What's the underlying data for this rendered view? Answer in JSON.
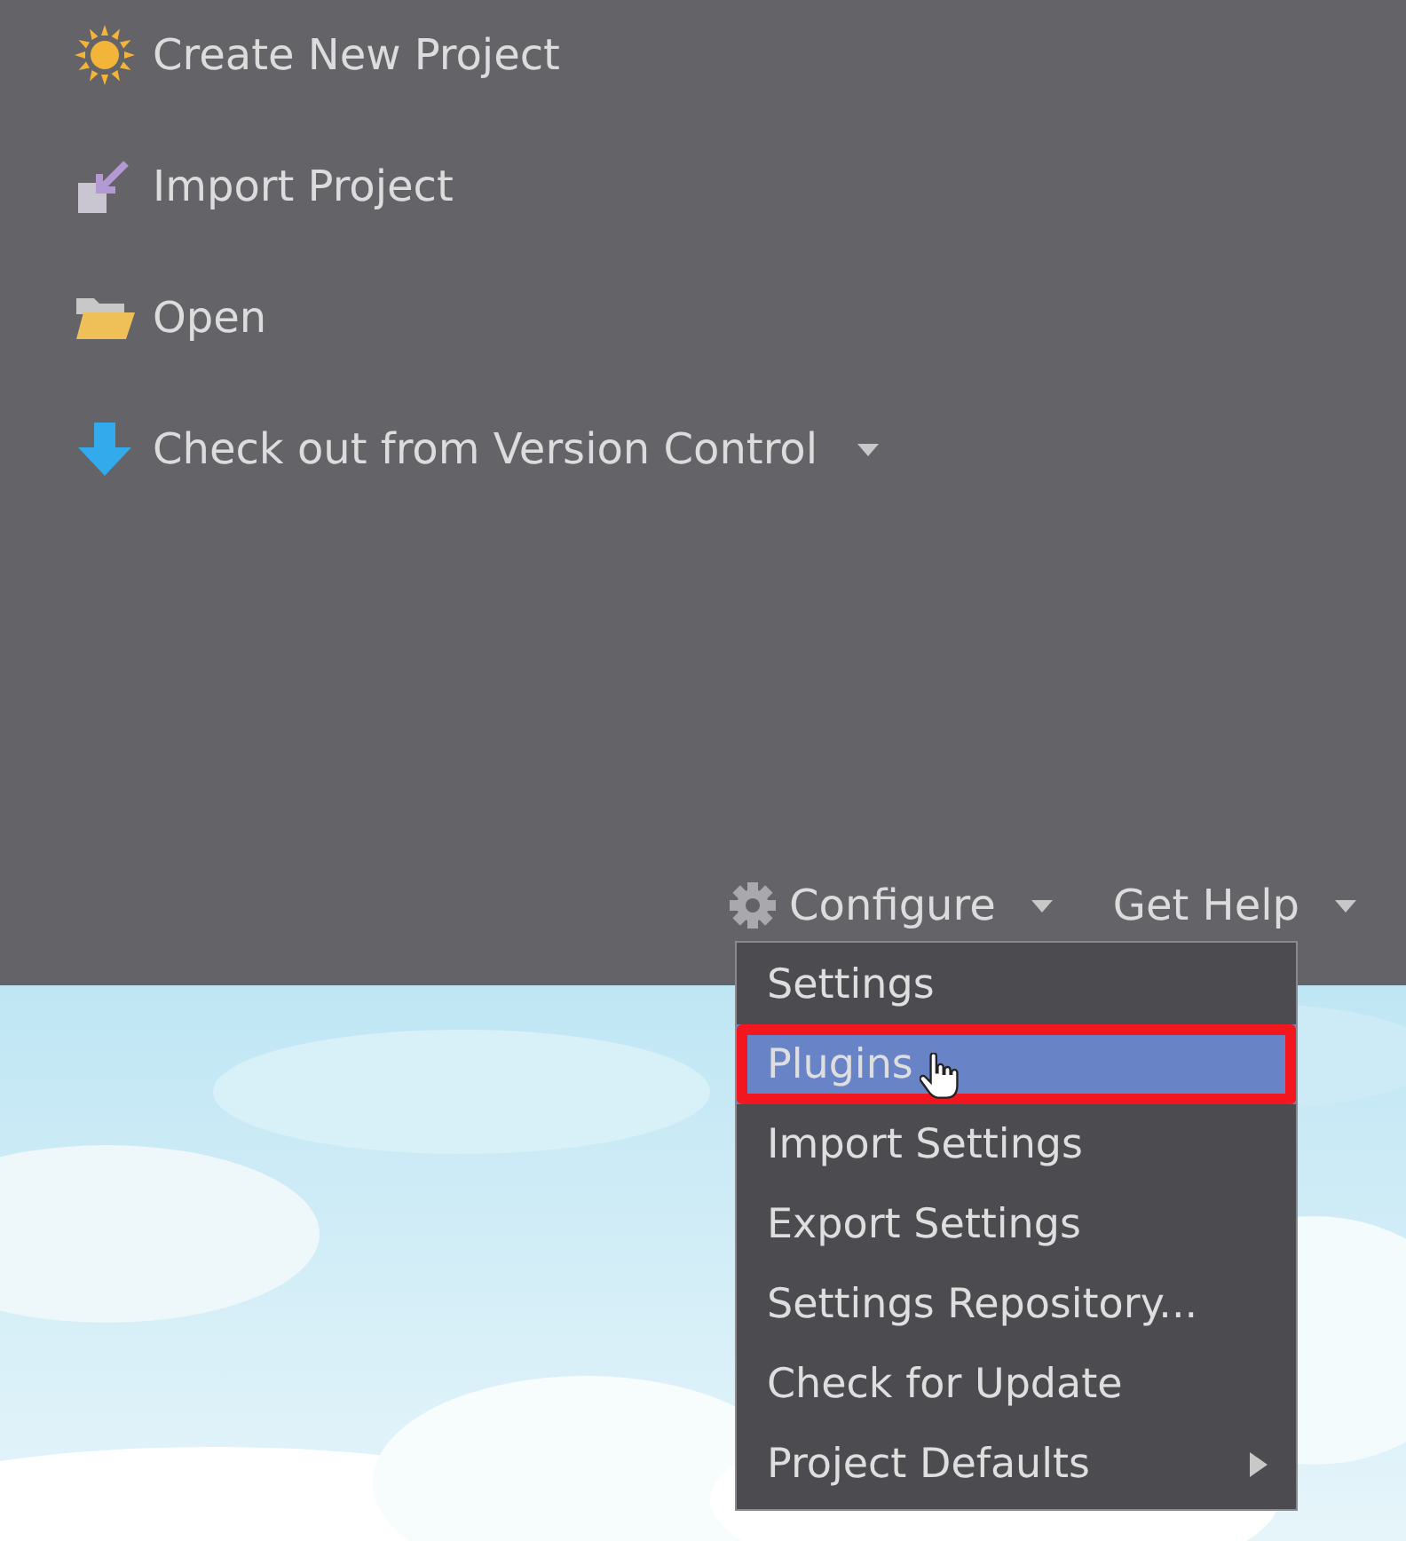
{
  "actions": [
    {
      "label": "Create New Project",
      "kind": "new",
      "dropdown": false
    },
    {
      "label": "Import Project",
      "kind": "import",
      "dropdown": false
    },
    {
      "label": "Open",
      "kind": "open",
      "dropdown": false
    },
    {
      "label": "Check out from Version Control",
      "kind": "vcs",
      "dropdown": true
    }
  ],
  "footer": [
    {
      "label": "Configure",
      "kind": "configure"
    },
    {
      "label": "Get Help",
      "kind": "help"
    }
  ],
  "configure_menu": {
    "items": [
      {
        "label": "Settings",
        "selected": false,
        "submenu": false,
        "circled": false,
        "cursor": false
      },
      {
        "label": "Plugins",
        "selected": true,
        "submenu": false,
        "circled": true,
        "cursor": true
      },
      {
        "label": "Import Settings",
        "selected": false,
        "submenu": false,
        "circled": false,
        "cursor": false
      },
      {
        "label": "Export Settings",
        "selected": false,
        "submenu": false,
        "circled": false,
        "cursor": false
      },
      {
        "label": "Settings Repository...",
        "selected": false,
        "submenu": false,
        "circled": false,
        "cursor": false
      },
      {
        "label": "Check for Update",
        "selected": false,
        "submenu": false,
        "circled": false,
        "cursor": false
      },
      {
        "label": "Project Defaults",
        "selected": false,
        "submenu": true,
        "circled": false,
        "cursor": false
      }
    ]
  }
}
